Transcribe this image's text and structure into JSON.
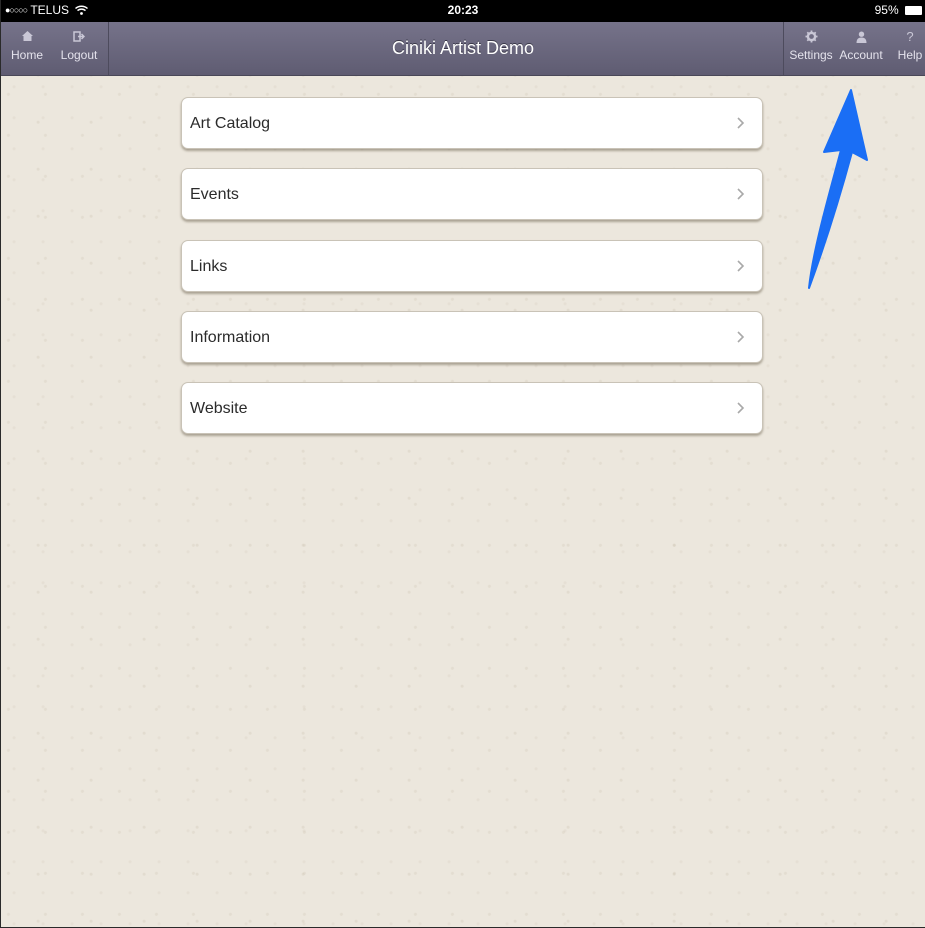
{
  "status_bar": {
    "signal": "●○○○○",
    "carrier": "TELUS",
    "wifi_icon": "wifi-icon",
    "time": "20:23",
    "battery": "95%"
  },
  "nav_bar": {
    "title": "Ciniki Artist Demo",
    "left_buttons": [
      {
        "label": "Home",
        "icon": "home-icon"
      },
      {
        "label": "Logout",
        "icon": "logout-icon"
      }
    ],
    "right_buttons": [
      {
        "label": "Settings",
        "icon": "gear-icon"
      },
      {
        "label": "Account",
        "icon": "person-icon"
      },
      {
        "label": "Help",
        "icon": "question-icon",
        "glyph": "?"
      }
    ]
  },
  "menu": {
    "items": [
      {
        "label": "Art Catalog"
      },
      {
        "label": "Events"
      },
      {
        "label": "Links"
      },
      {
        "label": "Information"
      },
      {
        "label": "Website"
      }
    ]
  },
  "colors": {
    "background": "#ece7dd",
    "nav_bar": "#6b687e",
    "arrow": "#1a6ef5"
  }
}
